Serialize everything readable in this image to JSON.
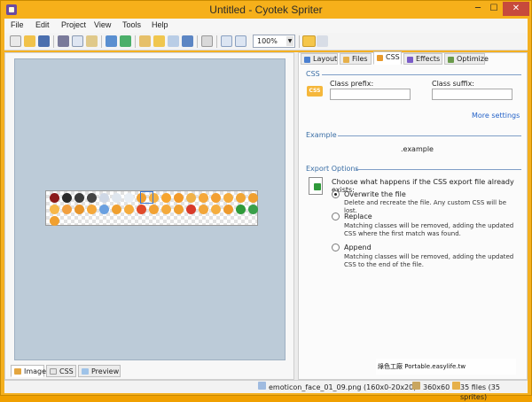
{
  "window": {
    "title": "Untitled - Cyotek Spriter",
    "minimize": "─",
    "maximize": "☐",
    "close": "✕"
  },
  "menu": [
    "File",
    "Edit",
    "Project",
    "View",
    "Tools",
    "Help"
  ],
  "toolbar": {
    "zoom_value": "100%",
    "icons": [
      "new-icon",
      "open-icon",
      "save-icon",
      "cut-icon",
      "copy-icon",
      "paste-icon",
      "import-icon",
      "export-icon",
      "add-image-icon",
      "add-folder-icon",
      "remove-icon",
      "delete-icon",
      "settings-icon",
      "view-grid-icon",
      "view-fit-icon",
      "panel-icon",
      "panel-toggle-icon"
    ]
  },
  "left_tabs": [
    {
      "label": "Image",
      "icon": "image-icon"
    },
    {
      "label": "CSS",
      "icon": "css-icon"
    },
    {
      "label": "Preview",
      "icon": "preview-icon"
    }
  ],
  "right_tabs": [
    {
      "label": "Layout",
      "icon": "layout-icon",
      "color": "#4a7fd0"
    },
    {
      "label": "Files",
      "icon": "files-icon",
      "color": "#e6b04a"
    },
    {
      "label": "CSS",
      "icon": "css-icon",
      "color": "#e89a2b"
    },
    {
      "label": "Effects",
      "icon": "effects-icon",
      "color": "#7a5bc8"
    },
    {
      "label": "Optimize",
      "icon": "optimize-icon",
      "color": "#6a9a4a"
    }
  ],
  "css_section": {
    "heading": "CSS",
    "badge": "CSS",
    "class_prefix_label": "Class prefix:",
    "class_prefix_value": "",
    "class_suffix_label": "Class suffix:",
    "class_suffix_value": "",
    "more_settings": "More settings"
  },
  "example_section": {
    "heading": "Example",
    "example_text": ".example"
  },
  "export_section": {
    "heading": "Export Options",
    "question": "Choose what happens if the CSS export file already exists:",
    "options": [
      {
        "label": "Overwrite the file",
        "desc": "Delete and recreate the file. Any custom CSS will be lost.",
        "selected": true
      },
      {
        "label": "Replace",
        "desc": "Matching classes will be removed, adding the updated CSS where the first match was found.",
        "selected": false
      },
      {
        "label": "Append",
        "desc": "Matching classes will be removed, adding the updated CSS to the end of the file.",
        "selected": false
      }
    ]
  },
  "status": {
    "selected_file": "emoticon_face_01_09.png (160x0-20x20)",
    "sheet_size": "360x60",
    "file_count": "35 files (35 sprites)"
  },
  "watermark": "綠色工廠 Portable.easylife.tw",
  "colors": {
    "accent": "#f6b01a",
    "canvas": "#bccbd8",
    "link": "#2563c8",
    "section_heading": "#3a6ea5"
  }
}
